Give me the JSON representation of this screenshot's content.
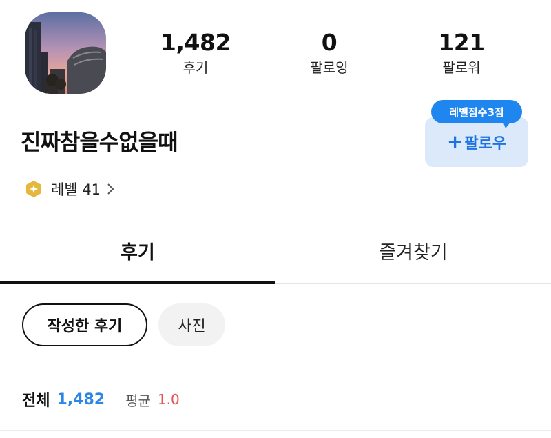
{
  "profile": {
    "username": "진짜참을수없을때",
    "level_label": "레벨 41"
  },
  "stats": {
    "reviews": {
      "value": "1,482",
      "label": "후기"
    },
    "following": {
      "value": "0",
      "label": "팔로잉"
    },
    "followers": {
      "value": "121",
      "label": "팔로워"
    }
  },
  "follow": {
    "tooltip": "레벨점수3점",
    "plus": "+",
    "label": "팔로우",
    "accent_color": "#1d73e3",
    "background_color": "#dbe9fa"
  },
  "tabs": [
    {
      "label": "후기",
      "active": true
    },
    {
      "label": "즐겨찾기",
      "active": false
    }
  ],
  "filters": [
    {
      "label": "작성한 후기",
      "selected": true
    },
    {
      "label": "사진",
      "selected": false
    }
  ],
  "summary": {
    "total_label": "전체",
    "total_value": "1,482",
    "average_label": "평균",
    "average_value": "1.0",
    "total_color": "#2b86e6",
    "average_color": "#e05555"
  },
  "icons": {
    "level": "level-badge-icon",
    "chevron": "chevron-right-icon",
    "avatar": "profile-photo-sunset-buildings"
  }
}
